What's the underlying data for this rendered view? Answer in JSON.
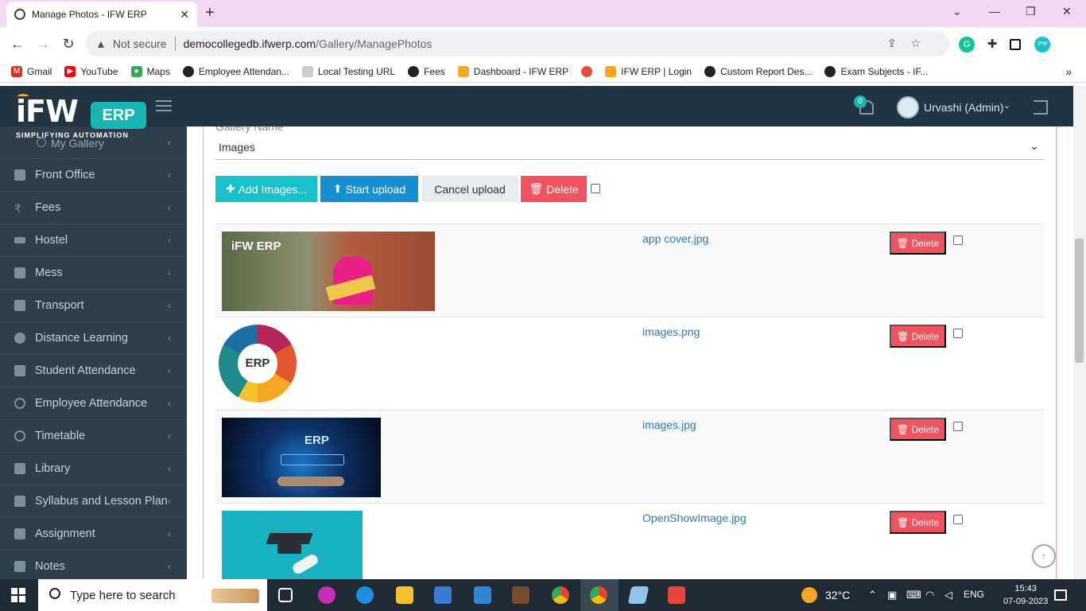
{
  "browser": {
    "tab_title": "Manage Photos - IFW ERP",
    "not_secure": "Not secure",
    "url_host": "democollegedb.ifwerp.com",
    "url_path": "/Gallery/ManagePhotos",
    "bookmarks": [
      {
        "label": "Gmail",
        "color": "#d93025"
      },
      {
        "label": "YouTube",
        "color": "#ff0000"
      },
      {
        "label": "Maps",
        "color": "#34a853"
      },
      {
        "label": "Employee Attendan...",
        "color": "#222222"
      },
      {
        "label": "Local Testing URL",
        "color": "#999999"
      },
      {
        "label": "Fees",
        "color": "#222222"
      },
      {
        "label": "Dashboard - IFW ERP",
        "color": "#f5a623"
      },
      {
        "label": "",
        "color": "#e74c3c"
      },
      {
        "label": "IFW ERP | Login",
        "color": "#f5a623"
      },
      {
        "label": "Custom Report Des...",
        "color": "#222222"
      },
      {
        "label": "Exam Subjects - IF...",
        "color": "#222222"
      }
    ]
  },
  "header": {
    "logo_text": "iFW",
    "logo_badge": "ERP",
    "logo_tagline": "SIMPLIFYING AUTOMATION",
    "notification_count": "0",
    "user_name": "Urvashi (Admin)"
  },
  "sidebar": {
    "top_item": "My Gallery",
    "items": [
      {
        "label": "Front Office"
      },
      {
        "label": "Fees"
      },
      {
        "label": "Hostel"
      },
      {
        "label": "Mess"
      },
      {
        "label": "Transport"
      },
      {
        "label": "Distance Learning"
      },
      {
        "label": "Student Attendance"
      },
      {
        "label": "Employee Attendance"
      },
      {
        "label": "Timetable"
      },
      {
        "label": "Library"
      },
      {
        "label": "Syllabus and Lesson Plan"
      },
      {
        "label": "Assignment"
      },
      {
        "label": "Notes"
      }
    ]
  },
  "main": {
    "gallery_label": "Gallery Name",
    "gallery_value": "Images",
    "toolbar": {
      "add_label": "Add Images...",
      "start_label": "Start upload",
      "cancel_label": "Cancel upload",
      "delete_label": "Delete"
    },
    "files": [
      {
        "name": "app cover.jpg",
        "delete_label": "Delete"
      },
      {
        "name": "images.png",
        "delete_label": "Delete"
      },
      {
        "name": "images.jpg",
        "delete_label": "Delete"
      },
      {
        "name": "OpenShowImage.jpg",
        "delete_label": "Delete"
      }
    ],
    "thumb_texts": {
      "cover_logo": "iFW ERP",
      "erp_wheel": "ERP",
      "erp_tablet": "ERP"
    }
  },
  "taskbar": {
    "search_placeholder": "Type here to search",
    "weather": "32°C",
    "language": "ENG",
    "time": "15:43",
    "date": "07-09-2023"
  },
  "colors": {
    "header_bg": "#233442",
    "sidebar_bg": "#2e3e4a",
    "add_btn": "#17c1c9",
    "start_btn": "#1690d2",
    "delete_btn": "#f3525f",
    "link": "#2a7ab5"
  }
}
